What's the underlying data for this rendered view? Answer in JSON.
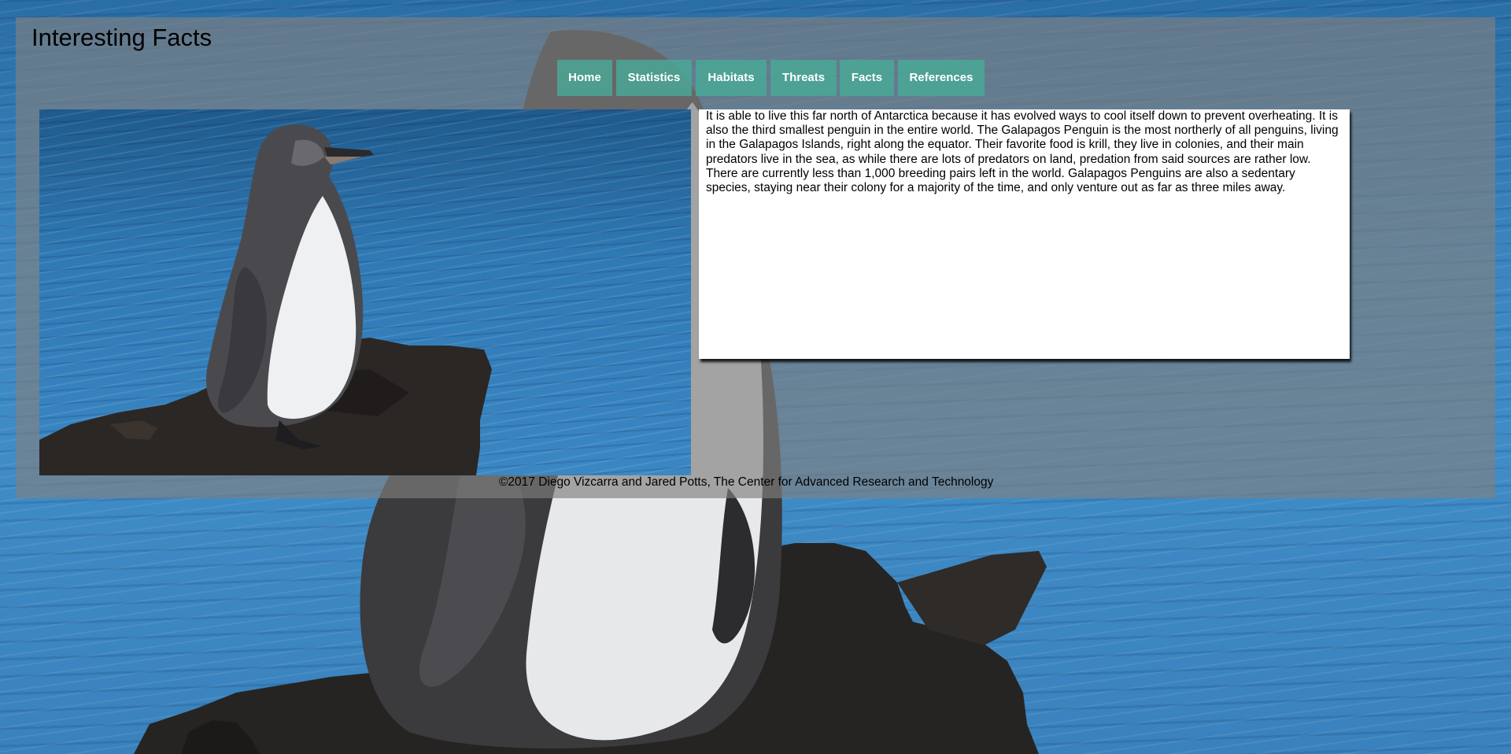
{
  "site": {
    "title": "Interesting Facts"
  },
  "nav": {
    "items": [
      {
        "label": "Home"
      },
      {
        "label": "Statistics"
      },
      {
        "label": "Habitats"
      },
      {
        "label": "Threats"
      },
      {
        "label": "Facts"
      },
      {
        "label": "References"
      }
    ]
  },
  "content": {
    "paragraph": "It is able to live this far north of Antarctica because it has evolved ways to cool itself down to prevent overheating. It is also the third smallest penguin in the entire world. The Galapagos Penguin is the most northerly of all penguins, living in the Galapagos Islands, right along the equator. Their favorite food is krill, they live in colonies, and their main predators live in the sea, as while there are lots of predators on land, predation from said sources are rather low. There are currently less than 1,000 breeding pairs left in the world. Galapagos Penguins are also a sedentary species, staying near their colony for a majority of the time, and only venture out as far as three miles away."
  },
  "footer": {
    "text": "©2017 Diego Vizcarra and Jared Potts, The Center for Advanced Research and Technology"
  },
  "colors": {
    "nav_button": "#48aa96",
    "panel_overlay": "#808080",
    "water": "#3a82bd"
  }
}
